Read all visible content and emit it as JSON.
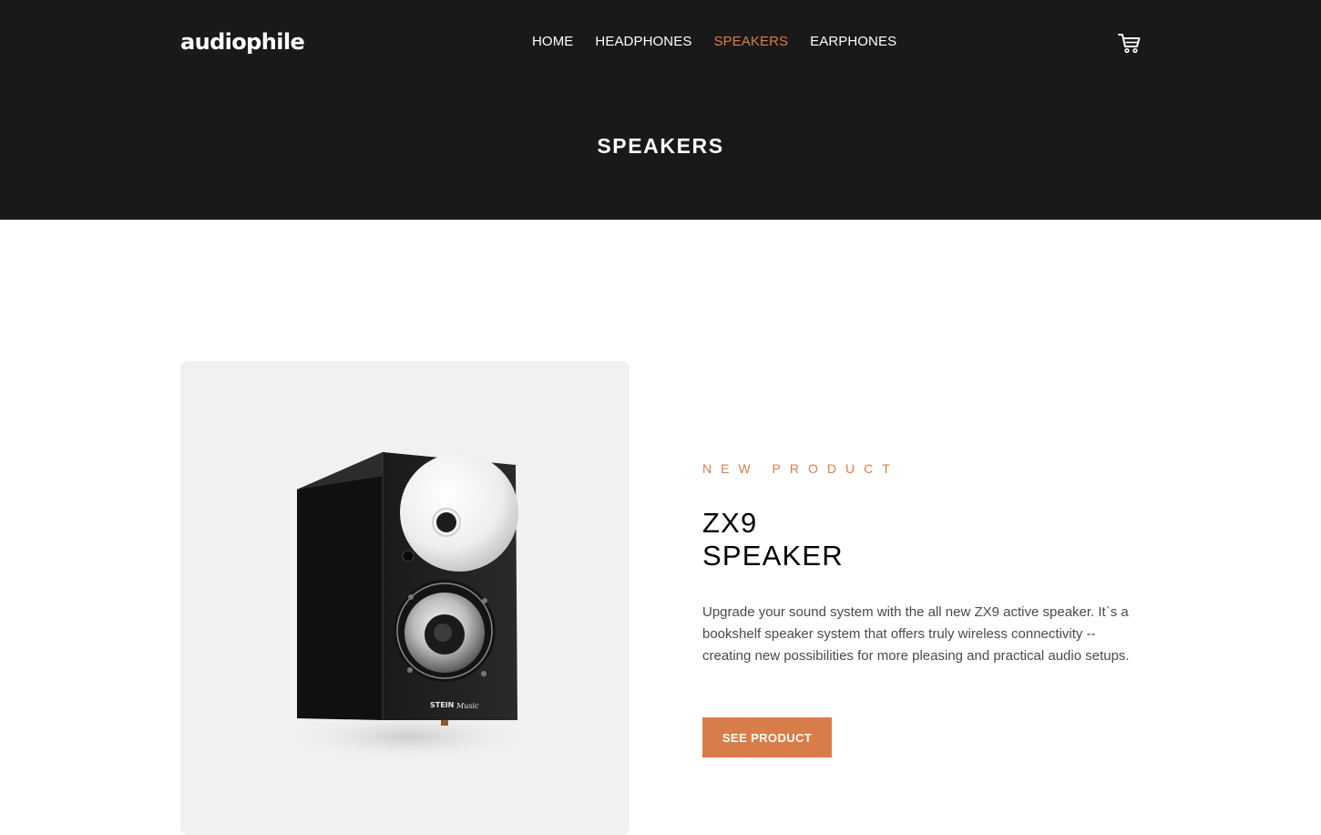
{
  "header": {
    "logo": "audiophile",
    "nav": [
      {
        "label": "HOME",
        "active": false
      },
      {
        "label": "HEADPHONES",
        "active": false
      },
      {
        "label": "SPEAKERS",
        "active": true
      },
      {
        "label": "EARPHONES",
        "active": false
      }
    ],
    "cart_icon": "cart-icon",
    "page_title": "SPEAKERS"
  },
  "product": {
    "eyebrow": "NEW PRODUCT",
    "title_line1": "ZX9",
    "title_line2": "SPEAKER",
    "description": "Upgrade your sound system with the all new ZX9 active speaker. It`s a bookshelf speaker system that offers truly wireless connectivity -- creating new possibilities for more pleasing and practical audio setups.",
    "button_label": "SEE PRODUCT",
    "image_brand": "STEIN Music"
  },
  "colors": {
    "header_bg": "#191919",
    "accent": "#d87d4a",
    "image_card_bg": "#f1f1f1"
  }
}
